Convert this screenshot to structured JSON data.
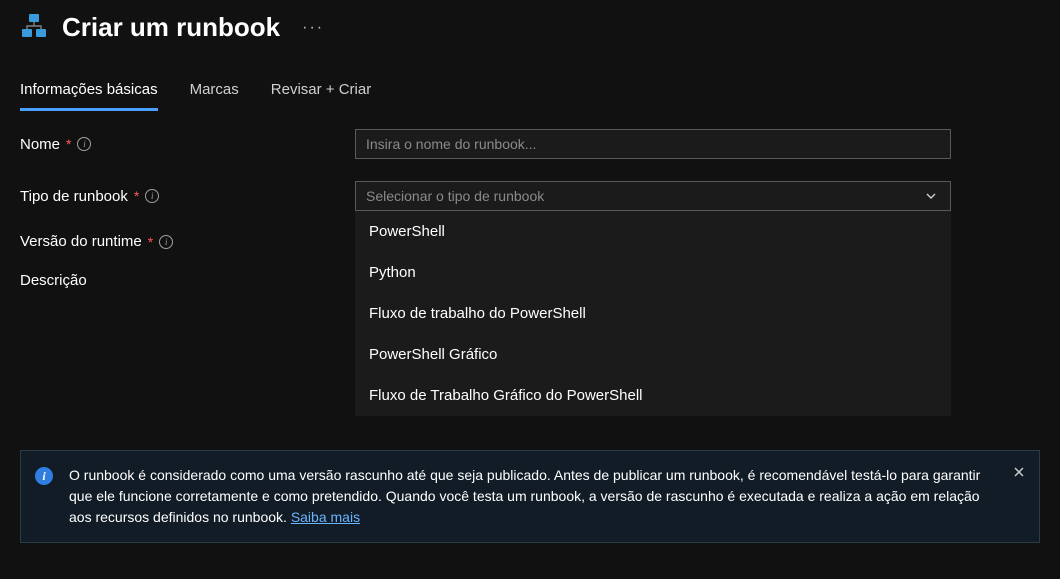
{
  "header": {
    "title": "Criar um runbook"
  },
  "tabs": {
    "basics": "Informações básicas",
    "tags": "Marcas",
    "review": "Revisar + Criar"
  },
  "form": {
    "name_label": "Nome",
    "name_placeholder": "Insira o nome do runbook...",
    "type_label": "Tipo de runbook",
    "type_placeholder": "Selecionar o tipo de runbook",
    "runtime_label": "Versão do runtime",
    "description_label": "Descrição",
    "type_options": {
      "powershell": "PowerShell",
      "python": "Python",
      "psworkflow": "Fluxo de trabalho do PowerShell",
      "psgraphical": "PowerShell Gráfico",
      "psgraphicalworkflow": "Fluxo de Trabalho Gráfico do PowerShell"
    }
  },
  "banner": {
    "text": "O runbook é considerado como uma versão rascunho até que seja publicado. Antes de publicar um runbook, é recomendável testá-lo para garantir que ele funcione corretamente e como pretendido. Quando você testa um runbook, a versão de rascunho é executada e realiza a ação em relação aos recursos definidos no runbook. ",
    "link": "Saiba mais"
  }
}
